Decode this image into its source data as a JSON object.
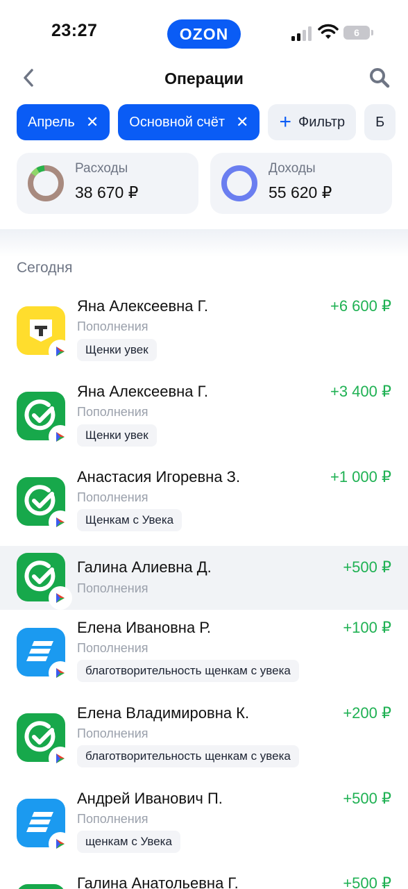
{
  "status_bar": {
    "time": "23:27",
    "brand": "OZON",
    "battery": "6"
  },
  "header": {
    "title": "Операции"
  },
  "filters": {
    "chips": [
      {
        "label": "Апрель"
      },
      {
        "label": "Основной счёт"
      }
    ],
    "filter_label": "Фильтр",
    "next_partial": "Б"
  },
  "summary": {
    "expenses": {
      "label": "Расходы",
      "value": "38 670 ₽"
    },
    "income": {
      "label": "Доходы",
      "value": "55 620 ₽"
    }
  },
  "section": {
    "title": "Сегодня"
  },
  "operations": [
    {
      "name": "Яна Алексеевна Г.",
      "category": "Пополнения",
      "amount": "+6 600 ₽",
      "tag": "Щенки увек",
      "icon": "tbank-icon"
    },
    {
      "name": "Яна Алексеевна Г.",
      "category": "Пополнения",
      "amount": "+3 400 ₽",
      "tag": "Щенки увек",
      "icon": "sber-icon"
    },
    {
      "name": "Анастасия Игоревна З.",
      "category": "Пополнения",
      "amount": "+1 000 ₽",
      "tag": "Щенкам с Увека",
      "icon": "sber-icon"
    },
    {
      "name": "Галина Алиевна Д.",
      "category": "Пополнения",
      "amount": "+500 ₽",
      "tag": "",
      "icon": "sber-icon"
    },
    {
      "name": "Елена Ивановна Р.",
      "category": "Пополнения",
      "amount": "+100 ₽",
      "tag": "благотворительность щенкам с увека",
      "icon": "vtb-icon"
    },
    {
      "name": "Елена Владимировна К.",
      "category": "Пополнения",
      "amount": "+200 ₽",
      "tag": "благотворительность щенкам с увека",
      "icon": "sber-icon"
    },
    {
      "name": "Андрей Иванович П.",
      "category": "Пополнения",
      "amount": "+500 ₽",
      "tag": "щенкам с Увека",
      "icon": "vtb-icon"
    },
    {
      "name": "Галина Анатольевна Г.",
      "category": "",
      "amount": "+500 ₽",
      "tag": "",
      "icon": "sber-icon"
    }
  ],
  "colors": {
    "accent": "#0a5cf5",
    "income_green": "#1fb153",
    "sber_green": "#17a84b",
    "vtb_blue": "#1b9af0",
    "tbank_yellow": "#ffdd2d"
  }
}
